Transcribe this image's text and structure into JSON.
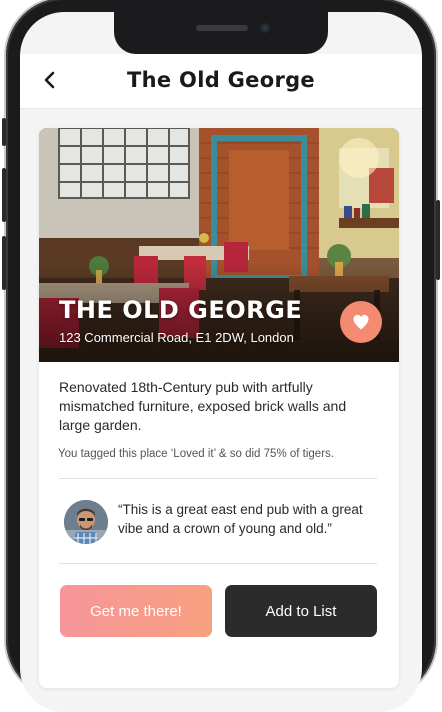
{
  "header": {
    "title": "The Old George"
  },
  "place": {
    "name": "THE OLD GEORGE",
    "address": "123 Commercial Road, E1 2DW, London",
    "description": "Renovated 18th-Century pub with artfully mismatched furniture, exposed brick walls and large garden.",
    "tag_note": "You tagged this place ‘Loved it’ & so did 75% of tigers."
  },
  "review": {
    "quote": "“This is a great east end pub with a great vibe and a crown of young and old.”"
  },
  "actions": {
    "primary_label": "Get me there!",
    "secondary_label": "Add to List"
  },
  "icons": {
    "back": "back-arrow-icon",
    "favorite": "heart-icon"
  },
  "colors": {
    "accent": "#f48a72",
    "primary_gradient_start": "#f7959a",
    "primary_gradient_end": "#f7a07f",
    "secondary_button": "#2b2b2b"
  }
}
